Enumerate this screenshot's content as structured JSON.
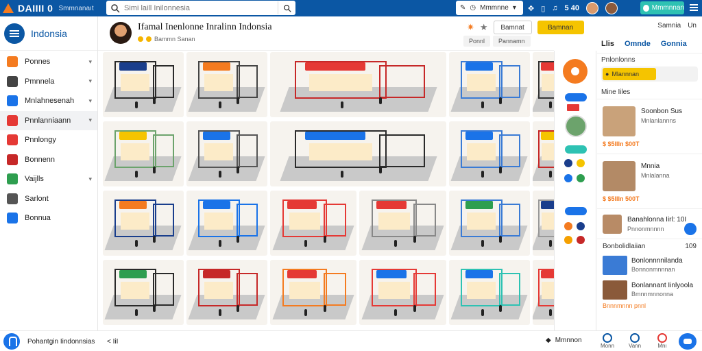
{
  "topbar": {
    "logo_text": "DAIIII 0",
    "logo_sub": "Smmnanaıt",
    "search_placeholder": "Simi laill Inilonnesia",
    "pill_label": "Mmmnne",
    "count": "5 40",
    "promo_label": "Mmmnnan",
    "colors": {
      "bar": "#0b57a4",
      "accent": "#f47b20",
      "promo": "#2ec2b3"
    }
  },
  "sidebar": {
    "title": "Indonsia",
    "items": [
      {
        "label": "Ponnes",
        "color": "#f47b20",
        "caret": true
      },
      {
        "label": "Pmnnela",
        "color": "#444444",
        "caret": true
      },
      {
        "label": "Mnlahnesenah",
        "color": "#1a73e8",
        "caret": true
      },
      {
        "label": "Pnnlanniaann",
        "color": "#e53935",
        "caret": true,
        "active": true
      },
      {
        "label": "Pnnlongy",
        "color": "#e53935",
        "caret": false
      },
      {
        "label": "Bonnenn",
        "color": "#c62828",
        "caret": false
      },
      {
        "label": "Vaijlls",
        "color": "#2e9e4f",
        "caret": true
      },
      {
        "label": "Sarlont",
        "color": "#555555",
        "caret": false
      },
      {
        "label": "Bonnua",
        "color": "#1a73e8",
        "caret": false
      }
    ]
  },
  "main": {
    "title": "Ifamal Inenlonne Inralinn Indonsia",
    "sub": "Bammn Sanan",
    "btn_outline": "Bamnat",
    "btn_yellow": "Bamnan",
    "tab1": "Ponnl",
    "tab2": "Pannamn"
  },
  "grid": {
    "tiles": [
      {
        "sign": "#1a3e8c",
        "wall": "#2a2a2a"
      },
      {
        "sign": "#f47b20",
        "wall": "#444444"
      },
      {
        "sign": "#e53935",
        "wall": "#c62828",
        "wide": true
      },
      {
        "sign": "#1a73e8",
        "wall": "#3a7bd5"
      },
      {
        "sign": "#e53935",
        "wall": "#333333"
      },
      {
        "sign": "#f5c400",
        "wall": "#6ca36c"
      },
      {
        "sign": "#1a73e8",
        "wall": "#555555"
      },
      {
        "sign": "#1a73e8",
        "wall": "#2a2a2a",
        "wide": true
      },
      {
        "sign": "#1a73e8",
        "wall": "#3a7bd5"
      },
      {
        "sign": "#f5c400",
        "wall": "#c62828"
      },
      {
        "sign": "#f47b20",
        "wall": "#1a3e8c"
      },
      {
        "sign": "#1a73e8",
        "wall": "#1a73e8"
      },
      {
        "sign": "#e53935",
        "wall": "#e53935"
      },
      {
        "sign": "#e53935",
        "wall": "#888888"
      },
      {
        "sign": "#2e9e4f",
        "wall": "#3a7bd5"
      },
      {
        "sign": "#1a3e8c",
        "wall": "#999999"
      },
      {
        "sign": "#2e9e4f",
        "wall": "#2a2a2a"
      },
      {
        "sign": "#c62828",
        "wall": "#c62828"
      },
      {
        "sign": "#e53935",
        "wall": "#f47b20"
      },
      {
        "sign": "#1a73e8",
        "wall": "#e53935"
      },
      {
        "sign": "#1a73e8",
        "wall": "#2ec2b3"
      },
      {
        "sign": "#e53935",
        "wall": "#e53935"
      }
    ]
  },
  "right": {
    "top_label": "Samnia",
    "top_label2": "Un",
    "tabs": [
      "Llis",
      "Omnde",
      "Gonnia"
    ],
    "label1": "Pnlonlonns",
    "search_label": "Mlannnan",
    "section1": "Mine Iiles",
    "cards": [
      {
        "title": "Soonbon Sus",
        "sub": "Mnlanlannns",
        "price": "$ $5IIIn $00T"
      },
      {
        "title": "Mnnia",
        "sub": "Mnlalanna",
        "price": "$ $5IIIn 500T"
      }
    ],
    "msg": {
      "title": "Banahlonna Iirl: 10I",
      "sub": "Pnnonmnnnn"
    },
    "news_head": "Bonbolidlaiian",
    "news_head_count": "109",
    "news": [
      {
        "title": "Bonlonnnnilanda",
        "sub": "Bonnonmnnnan"
      },
      {
        "title": "Bonlannant Iinlyoola",
        "sub": "Bmnnmnnonna"
      }
    ],
    "news_foot": "Bnnnmnnn pnnl"
  },
  "bottom": {
    "label": "Pohantgin Iindonnsias",
    "link": "< IiI",
    "right_label": "Mmnnon",
    "nav": [
      "Monn",
      "Vann",
      "Mnı"
    ]
  }
}
